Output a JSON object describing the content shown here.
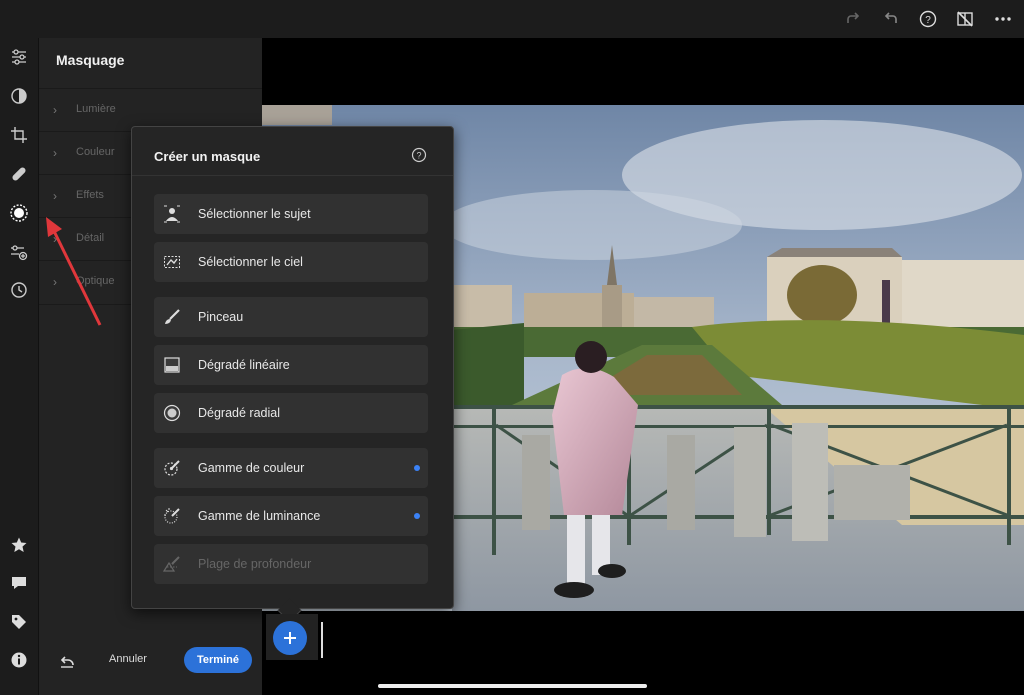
{
  "topbar": {
    "icons": [
      "redo-icon",
      "undo-icon",
      "help-icon",
      "compare-off-icon",
      "more-icon"
    ]
  },
  "rail": {
    "icons": [
      "edit-sliders-icon",
      "presets-icon",
      "crop-icon",
      "heal-icon",
      "masking-icon",
      "versions-icon",
      "history-icon",
      "star-icon",
      "comment-icon",
      "tag-icon",
      "info-icon"
    ]
  },
  "panel": {
    "title": "Masquage",
    "sections": [
      "Lumière",
      "Couleur",
      "Effets",
      "Détail",
      "Optique"
    ]
  },
  "footer": {
    "cancel_label": "Annuler",
    "done_label": "Terminé"
  },
  "popup": {
    "title": "Créer un masque",
    "options": [
      {
        "label": "Sélectionner le sujet",
        "icon": "select-subject-icon",
        "badge": false,
        "enabled": true
      },
      {
        "label": "Sélectionner le ciel",
        "icon": "select-sky-icon",
        "badge": false,
        "enabled": true
      },
      {
        "label": "Pinceau",
        "icon": "brush-icon",
        "badge": false,
        "enabled": true
      },
      {
        "label": "Dégradé linéaire",
        "icon": "linear-gradient-icon",
        "badge": false,
        "enabled": true
      },
      {
        "label": "Dégradé radial",
        "icon": "radial-gradient-icon",
        "badge": false,
        "enabled": true
      },
      {
        "label": "Gamme de couleur",
        "icon": "color-range-icon",
        "badge": true,
        "enabled": true
      },
      {
        "label": "Gamme de luminance",
        "icon": "luminance-range-icon",
        "badge": true,
        "enabled": true
      },
      {
        "label": "Plage de profondeur",
        "icon": "depth-range-icon",
        "badge": false,
        "enabled": false
      }
    ]
  },
  "colors": {
    "accent": "#2c72d9",
    "badge": "#3b82f6",
    "annotation": "#e0373b"
  }
}
